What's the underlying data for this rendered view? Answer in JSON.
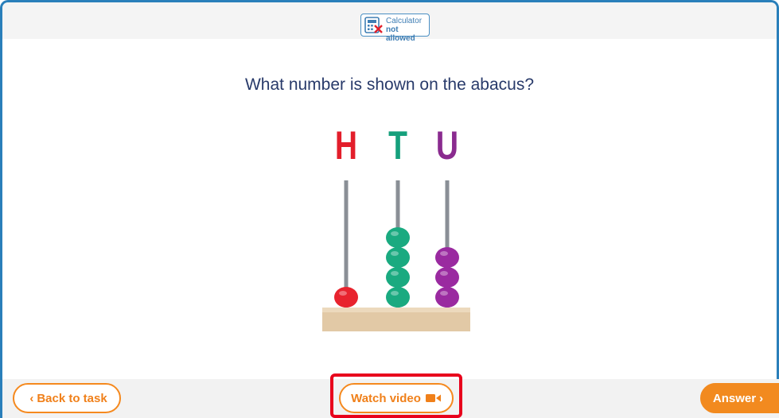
{
  "calculator_badge": {
    "line1": "Calculator",
    "line2": "not allowed",
    "icon": "calculator-crossed-icon"
  },
  "question": "What number is shown on the abacus?",
  "abacus": {
    "columns": [
      {
        "label": "H",
        "color": "#e31e2b",
        "beads": 1,
        "bead_color": "#e8232e"
      },
      {
        "label": "T",
        "color": "#15a07c",
        "beads": 4,
        "bead_color": "#1aaa80"
      },
      {
        "label": "U",
        "color": "#8a2b8f",
        "beads": 3,
        "bead_color": "#9a2aa0"
      }
    ],
    "base_color": "#e2c9a6"
  },
  "buttons": {
    "back_label": "Back to task",
    "video_label": "Watch video",
    "answer_label": "Answer"
  },
  "colors": {
    "accent": "#f28a1f",
    "highlight": "#e8001c",
    "frame": "#2a7fba"
  }
}
